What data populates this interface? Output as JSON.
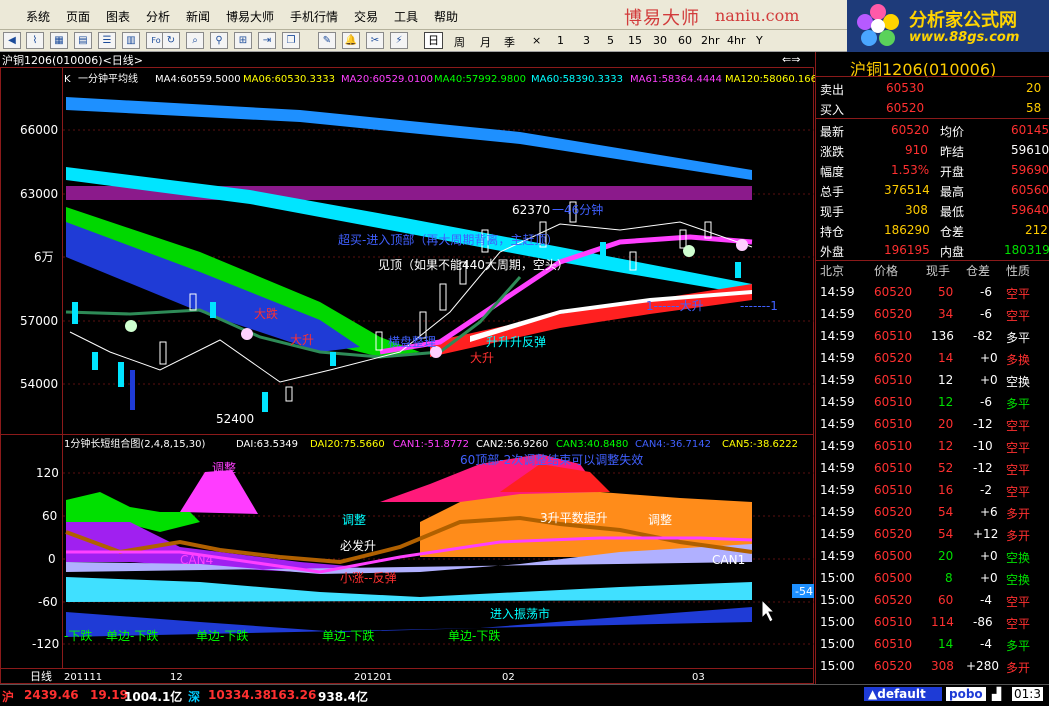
{
  "menu": [
    "系统",
    "页面",
    "图表",
    "分析",
    "新闻",
    "博易大师",
    "手机行情",
    "交易",
    "工具",
    "帮助"
  ],
  "brand": {
    "cn": "博易大师",
    "url": "naniu.com"
  },
  "logo": {
    "title": "分析家公式网",
    "url": "www.88gs.com"
  },
  "toolbar": {
    "periods": [
      "日",
      "周",
      "月",
      "季",
      "×",
      "1",
      "3",
      "5",
      "15",
      "30",
      "60",
      "2hr",
      "4hr",
      "Y"
    ],
    "active": "日"
  },
  "chart_header": {
    "symbol": "沪铜1206(010006)<日线>",
    "arrows": "⇐⇒"
  },
  "main_chart": {
    "title_k": "K",
    "title": "一分钟平均线",
    "ma": [
      {
        "label": "MA4:60559.5000",
        "color": "#ffffff"
      },
      {
        "label": "MA06:60530.3333",
        "color": "#ffff00"
      },
      {
        "label": "MA20:60529.0100",
        "color": "#ff40ff"
      },
      {
        "label": "MA40:57992.9800",
        "color": "#00ff00"
      },
      {
        "label": "MA60:58390.3333",
        "color": "#00ffff"
      },
      {
        "label": "MA61:58364.4444",
        "color": "#ff40ff"
      },
      {
        "label": "MA120:58060.166",
        "color": "#ffff00"
      }
    ],
    "y_labels": [
      "66000",
      "63000",
      "6万",
      "57000",
      "54000"
    ],
    "annotations": {
      "hi": "62370",
      "hi_label": "一46分钟",
      "lo": "52400",
      "overbought": "超买-进入顶部（再大周期背离，主赶顶）",
      "top_line": "见顶（如果不能440大周期，空头）",
      "trend_up": "大升",
      "trend_up2": "大升",
      "rebound": "升升升反弹",
      "confirm": "横盘整理",
      "decline": "大跌",
      "right_mark": "1------大升",
      "right_mark2": "-------1"
    }
  },
  "sub_chart": {
    "title": "1分钟长短组合图(2,4,8,15,30)",
    "values": [
      {
        "label": "DAI:63.5349",
        "color": "#ffffff"
      },
      {
        "label": "DAI20:75.5660",
        "color": "#ffff00"
      },
      {
        "label": "CAN1:-51.8772",
        "color": "#ff40ff"
      },
      {
        "label": "CAN2:56.9260",
        "color": "#ffffff"
      },
      {
        "label": "CAN3:40.8480",
        "color": "#00ff00"
      },
      {
        "label": "CAN4:-36.7142",
        "color": "#4060ff"
      },
      {
        "label": "CAN5:-38.6222",
        "color": "#ffff00"
      }
    ],
    "y_labels": [
      "120",
      "60",
      "0",
      "-60",
      "-120"
    ],
    "current_value": "-54",
    "annotations": {
      "top": "60顶部-2次调整结束可以调整失效",
      "adjust": "调整",
      "adjust2": "调整",
      "adjust3": "调整",
      "rise": "3升平数据升",
      "start_up": "必发升",
      "small_up": "小涨--反弹",
      "enter_range": "进入振荡市",
      "down_labels": [
        "-下跌",
        "单边-下跌",
        "单边-下跌",
        "单边-下跌",
        "单边-下跌"
      ],
      "can_label": "CAN4",
      "can_label2": "CAN1"
    }
  },
  "x_axis": {
    "labels": [
      "201111",
      "12",
      "201201",
      "02",
      "03"
    ],
    "period_label": "日线"
  },
  "quote": {
    "title": "沪铜1206(010006)",
    "sell": {
      "label": "卖出",
      "price": "60530",
      "vol": "20"
    },
    "buy": {
      "label": "买入",
      "price": "60520",
      "vol": "58"
    },
    "rows": [
      {
        "l1": "最新",
        "v1": "60520",
        "c1": "red",
        "l2": "均价",
        "v2": "60145",
        "c2": "red"
      },
      {
        "l1": "涨跌",
        "v1": "910",
        "c1": "red",
        "l2": "昨结",
        "v2": "59610",
        "c2": "wht"
      },
      {
        "l1": "幅度",
        "v1": "1.53%",
        "c1": "red",
        "l2": "开盘",
        "v2": "59690",
        "c2": "red"
      },
      {
        "l1": "总手",
        "v1": "376514",
        "c1": "ylw",
        "l2": "最高",
        "v2": "60560",
        "c2": "red"
      },
      {
        "l1": "现手",
        "v1": "308",
        "c1": "ylw",
        "l2": "最低",
        "v2": "59640",
        "c2": "red"
      },
      {
        "l1": "持仓",
        "v1": "186290",
        "c1": "ylw",
        "l2": "仓差",
        "v2": "212",
        "c2": "ylw"
      },
      {
        "l1": "外盘",
        "v1": "196195",
        "c1": "red",
        "l2": "内盘",
        "v2": "180319",
        "c2": "grn"
      }
    ],
    "tick_head": {
      "city": "北京",
      "price": "价格",
      "now": "现手",
      "diff": "仓差",
      "nature": "性质"
    },
    "ticks": [
      {
        "t": "14:59",
        "p": "60520",
        "v": "50",
        "vc": "red",
        "d": "-6",
        "n": "空平",
        "nc": "red"
      },
      {
        "t": "14:59",
        "p": "60520",
        "v": "34",
        "vc": "red",
        "d": "-6",
        "n": "空平",
        "nc": "red"
      },
      {
        "t": "14:59",
        "p": "60510",
        "v": "136",
        "vc": "wht",
        "d": "-82",
        "n": "多平",
        "nc": "wht"
      },
      {
        "t": "14:59",
        "p": "60520",
        "v": "14",
        "vc": "red",
        "d": "+0",
        "n": "多换",
        "nc": "red"
      },
      {
        "t": "14:59",
        "p": "60510",
        "v": "12",
        "vc": "wht",
        "d": "+0",
        "n": "空换",
        "nc": "wht"
      },
      {
        "t": "14:59",
        "p": "60510",
        "v": "12",
        "vc": "grn",
        "d": "-6",
        "n": "多平",
        "nc": "grn"
      },
      {
        "t": "14:59",
        "p": "60510",
        "v": "20",
        "vc": "red",
        "d": "-12",
        "n": "空平",
        "nc": "red"
      },
      {
        "t": "14:59",
        "p": "60510",
        "v": "12",
        "vc": "red",
        "d": "-10",
        "n": "空平",
        "nc": "red"
      },
      {
        "t": "14:59",
        "p": "60510",
        "v": "52",
        "vc": "red",
        "d": "-12",
        "n": "空平",
        "nc": "red"
      },
      {
        "t": "14:59",
        "p": "60510",
        "v": "16",
        "vc": "red",
        "d": "-2",
        "n": "空平",
        "nc": "red"
      },
      {
        "t": "14:59",
        "p": "60520",
        "v": "54",
        "vc": "red",
        "d": "+6",
        "n": "多开",
        "nc": "red"
      },
      {
        "t": "14:59",
        "p": "60520",
        "v": "54",
        "vc": "red",
        "d": "+12",
        "n": "多开",
        "nc": "red"
      },
      {
        "t": "14:59",
        "p": "60500",
        "v": "20",
        "vc": "grn",
        "d": "+0",
        "n": "空换",
        "nc": "grn"
      },
      {
        "t": "15:00",
        "p": "60500",
        "v": "8",
        "vc": "grn",
        "d": "+0",
        "n": "空换",
        "nc": "grn"
      },
      {
        "t": "15:00",
        "p": "60520",
        "v": "60",
        "vc": "red",
        "d": "-4",
        "n": "空平",
        "nc": "red"
      },
      {
        "t": "15:00",
        "p": "60510",
        "v": "114",
        "vc": "red",
        "d": "-86",
        "n": "空平",
        "nc": "red"
      },
      {
        "t": "15:00",
        "p": "60510",
        "v": "14",
        "vc": "grn",
        "d": "-4",
        "n": "多平",
        "nc": "grn"
      },
      {
        "t": "15:00",
        "p": "60520",
        "v": "308",
        "vc": "red",
        "d": "+280",
        "n": "多开",
        "nc": "red"
      }
    ]
  },
  "statusbar": {
    "sh_label": "沪",
    "sh_index": "2439.46",
    "sh_change": "19.19",
    "sh_amount": "1004.1亿",
    "sz_label": "深",
    "sz_index": "10334.38",
    "sz_change": "163.26",
    "sz_amount": "938.4亿",
    "scheme": "default",
    "pobo": "pobo",
    "time": "01:3"
  }
}
